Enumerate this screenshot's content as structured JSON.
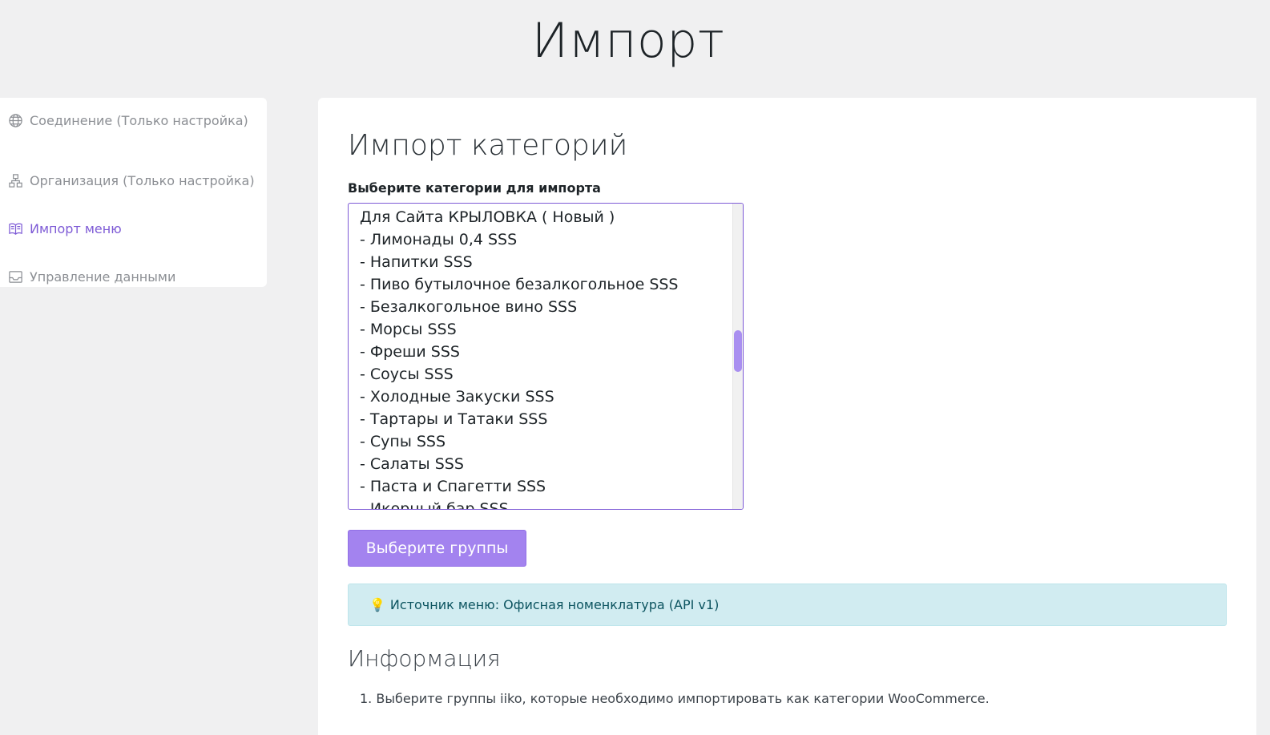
{
  "page": {
    "title": "Импорт"
  },
  "sidebar": {
    "items": [
      {
        "label": "Соединение (Только настройка)",
        "icon": "globe-icon",
        "active": false
      },
      {
        "label": "Организация (Только настройка)",
        "icon": "sitemap-icon",
        "active": false
      },
      {
        "label": "Импорт меню",
        "icon": "book-icon",
        "active": true
      },
      {
        "label": "Управление данными",
        "icon": "inbox-icon",
        "active": false
      }
    ]
  },
  "main": {
    "section_title": "Импорт категорий",
    "select_label": "Выберите категории для импорта",
    "categories": [
      "Для Сайта КРЫЛОВКА ( Новый )",
      "- Лимонады 0,4 SSS",
      "- Напитки SSS",
      "- Пиво бутылочное безалкогольное SSS",
      "- Безалкогольное вино SSS",
      "- Морсы SSS",
      "- Фреши SSS",
      "- Соусы SSS",
      "- Холодные Закуски SSS",
      "- Тартары и Татаки SSS",
      "- Супы SSS",
      "- Салаты SSS",
      "- Паста и Спагетти SSS",
      "- Икорный бар SSS"
    ],
    "button_label": "Выберите группы",
    "notice": {
      "icon": "lightbulb-icon",
      "text": "Источник меню: Офисная номенклатура (API v1)"
    },
    "info_title": "Информация",
    "info_items": [
      "1. Выберите группы iiko, которые необходимо импортировать как категории WooCommerce."
    ]
  },
  "colors": {
    "accent": "#7e5bd6",
    "button": "#a383ef",
    "notice_bg": "#d1ecf1",
    "notice_text": "#0c5460"
  }
}
